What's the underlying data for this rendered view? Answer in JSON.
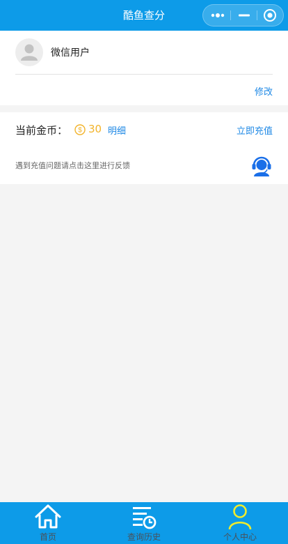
{
  "navbar": {
    "title": "酷鱼查分"
  },
  "capsule": {
    "icons": [
      "more-icon",
      "minimize-icon",
      "close-target-icon"
    ]
  },
  "user": {
    "name": "微信用户",
    "avatar_icon": "default-avatar-icon",
    "edit_label": "修改"
  },
  "coins": {
    "label": "当前金币：",
    "icon": "coin-icon",
    "amount": "30",
    "detail_label": "明细",
    "recharge_label": "立即充值",
    "feedback_text": "遇到充值问题请点击这里进行反馈",
    "support_icon": "customer-service-icon"
  },
  "tabbar": {
    "items": [
      {
        "label": "首页",
        "icon": "home-icon",
        "active": false
      },
      {
        "label": "查询历史",
        "icon": "history-icon",
        "active": false
      },
      {
        "label": "个人中心",
        "icon": "user-icon",
        "active": true
      }
    ],
    "active_color": "#f1ec2c"
  },
  "colors": {
    "primary": "#0d9be8",
    "link": "#1e88e5",
    "coin": "#f2b32a",
    "support_icon": "#1a6fe8"
  }
}
